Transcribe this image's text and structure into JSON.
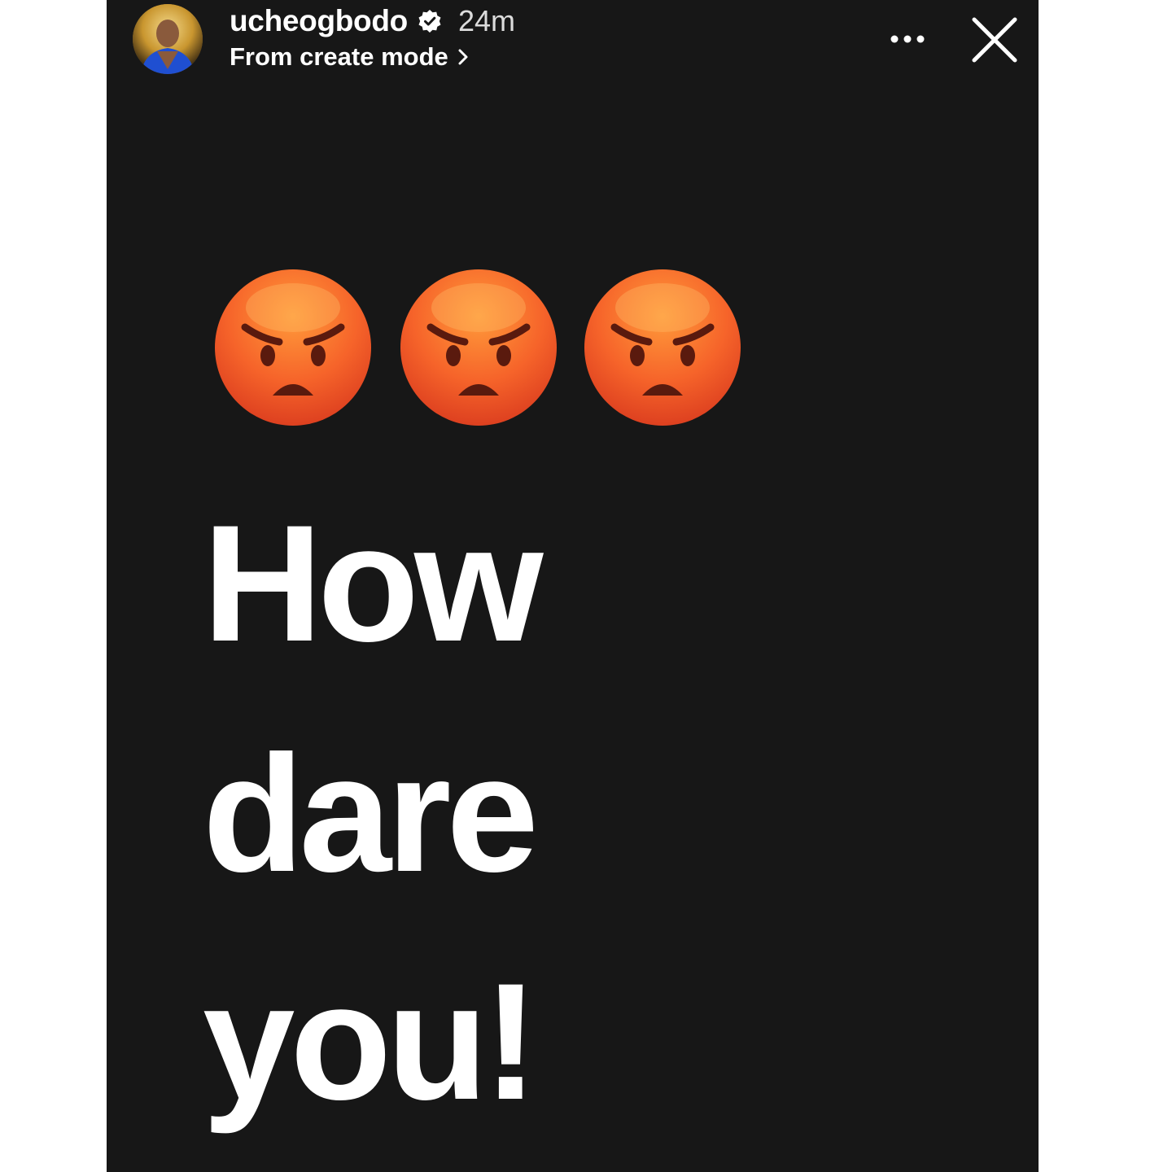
{
  "story": {
    "background_color": "#171717",
    "header": {
      "username": "ucheogbodo",
      "verified": true,
      "time_ago": "24m",
      "subtitle": "From create mode",
      "avatar_icon": "profile-photo",
      "more_icon": "more-horizontal-icon",
      "close_icon": "close-icon"
    },
    "content": {
      "emojis": [
        "angry-face",
        "angry-face",
        "angry-face"
      ],
      "lines": [
        "How",
        "dare",
        "you!"
      ],
      "text_color": "#ffffff"
    }
  }
}
